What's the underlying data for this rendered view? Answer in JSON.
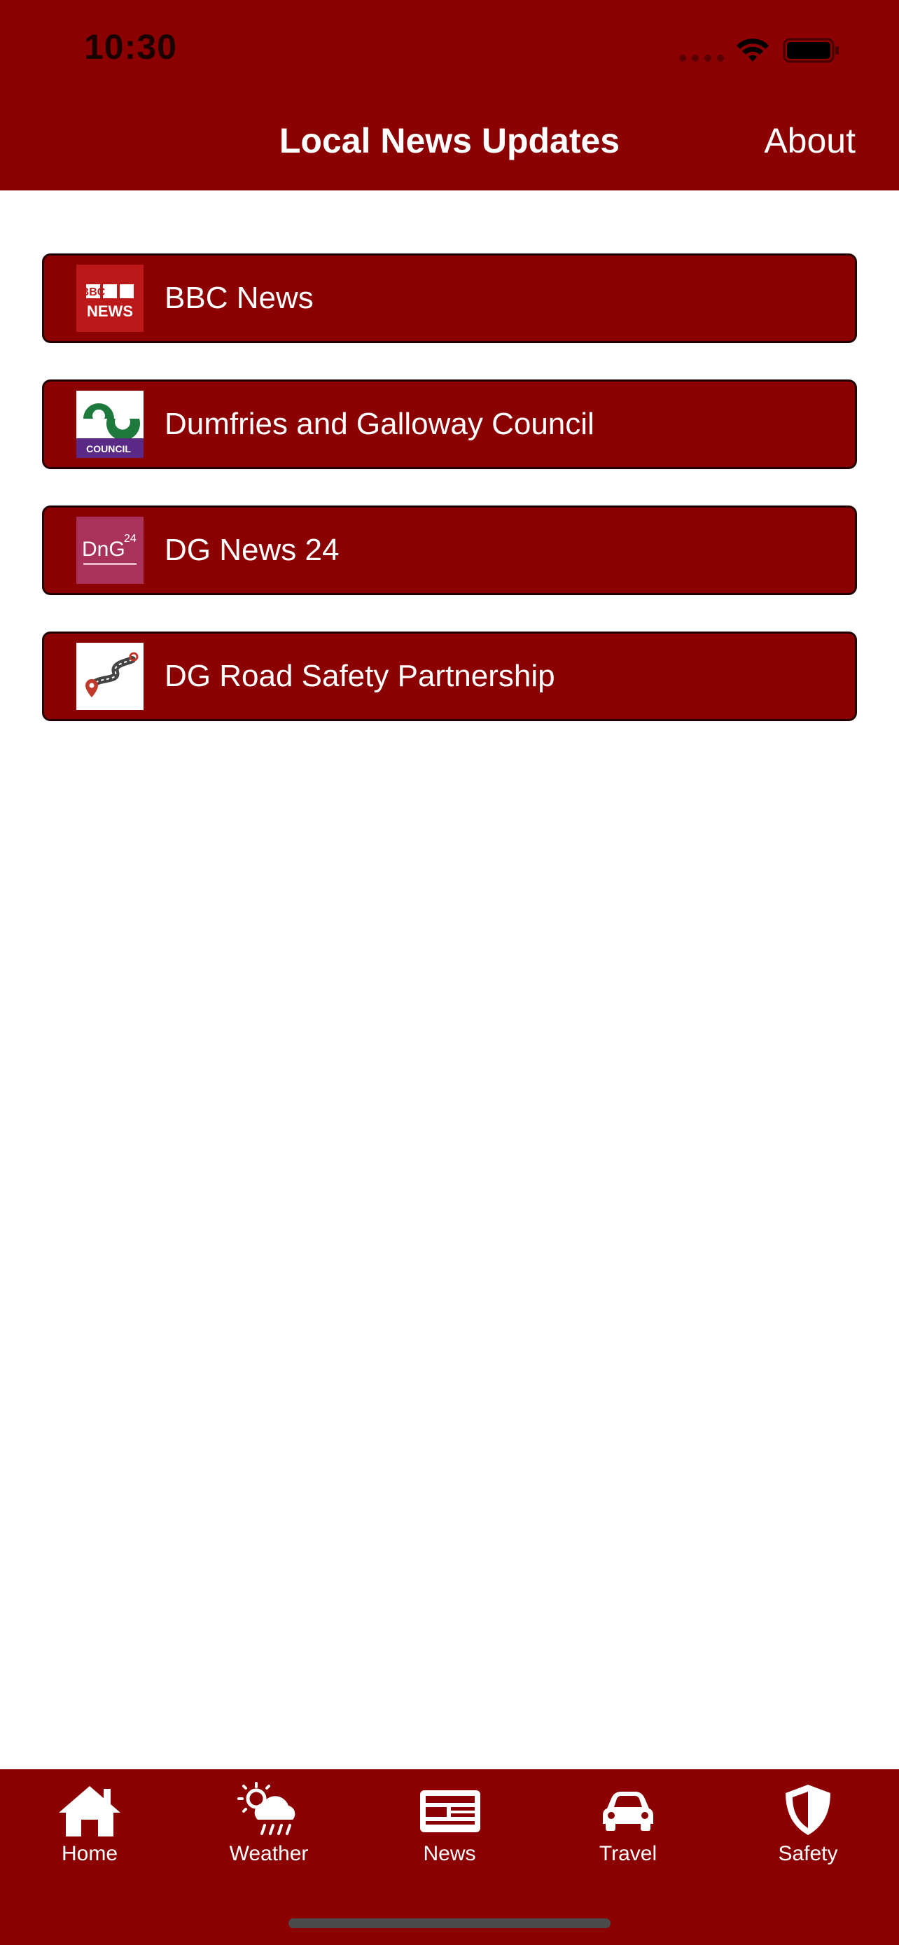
{
  "status_bar": {
    "time": "10:30"
  },
  "nav": {
    "title": "Local News Updates",
    "about_label": "About"
  },
  "sources": [
    {
      "label": "BBC News",
      "icon": "bbc-news-logo",
      "logo_text_top": "BBC",
      "logo_text_bottom": "NEWS"
    },
    {
      "label": "Dumfries and Galloway Council",
      "icon": "dg-council-logo",
      "logo_text": "COUNCIL"
    },
    {
      "label": "DG News 24",
      "icon": "dng24-logo",
      "logo_text": "DnG",
      "logo_sup": "24"
    },
    {
      "label": "DG Road Safety Partnership",
      "icon": "road-safety-logo"
    }
  ],
  "tabs": [
    {
      "label": "Home",
      "icon": "home-icon"
    },
    {
      "label": "Weather",
      "icon": "weather-icon"
    },
    {
      "label": "News",
      "icon": "news-icon"
    },
    {
      "label": "Travel",
      "icon": "car-icon"
    },
    {
      "label": "Safety",
      "icon": "shield-icon"
    }
  ],
  "colors": {
    "primary": "#8b0000",
    "bbc_red": "#bb1919",
    "council_green": "#1e7a3c",
    "council_purple": "#5b2a86",
    "dng_pink": "#a8325a"
  }
}
